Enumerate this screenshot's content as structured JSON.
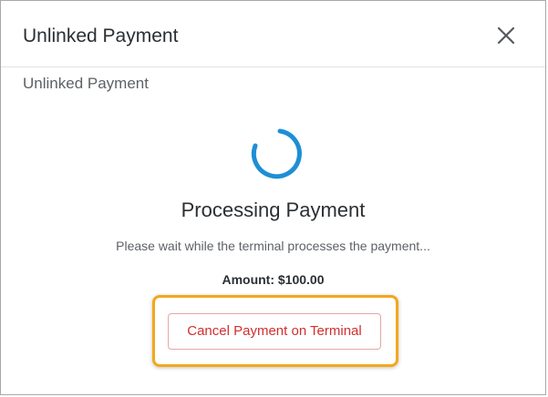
{
  "dialog": {
    "title": "Unlinked Payment",
    "subtitle": "Unlinked Payment",
    "close_icon": "close-icon"
  },
  "status": {
    "spinner_icon": "spinner-icon",
    "heading": "Processing Payment",
    "message": "Please wait while the terminal processes the payment...",
    "amount": "Amount: $100.00"
  },
  "actions": {
    "cancel_label": "Cancel Payment on Terminal"
  },
  "colors": {
    "accent": "#1e8fd4",
    "danger": "#d12f2f",
    "highlight": "#f2a81d"
  }
}
